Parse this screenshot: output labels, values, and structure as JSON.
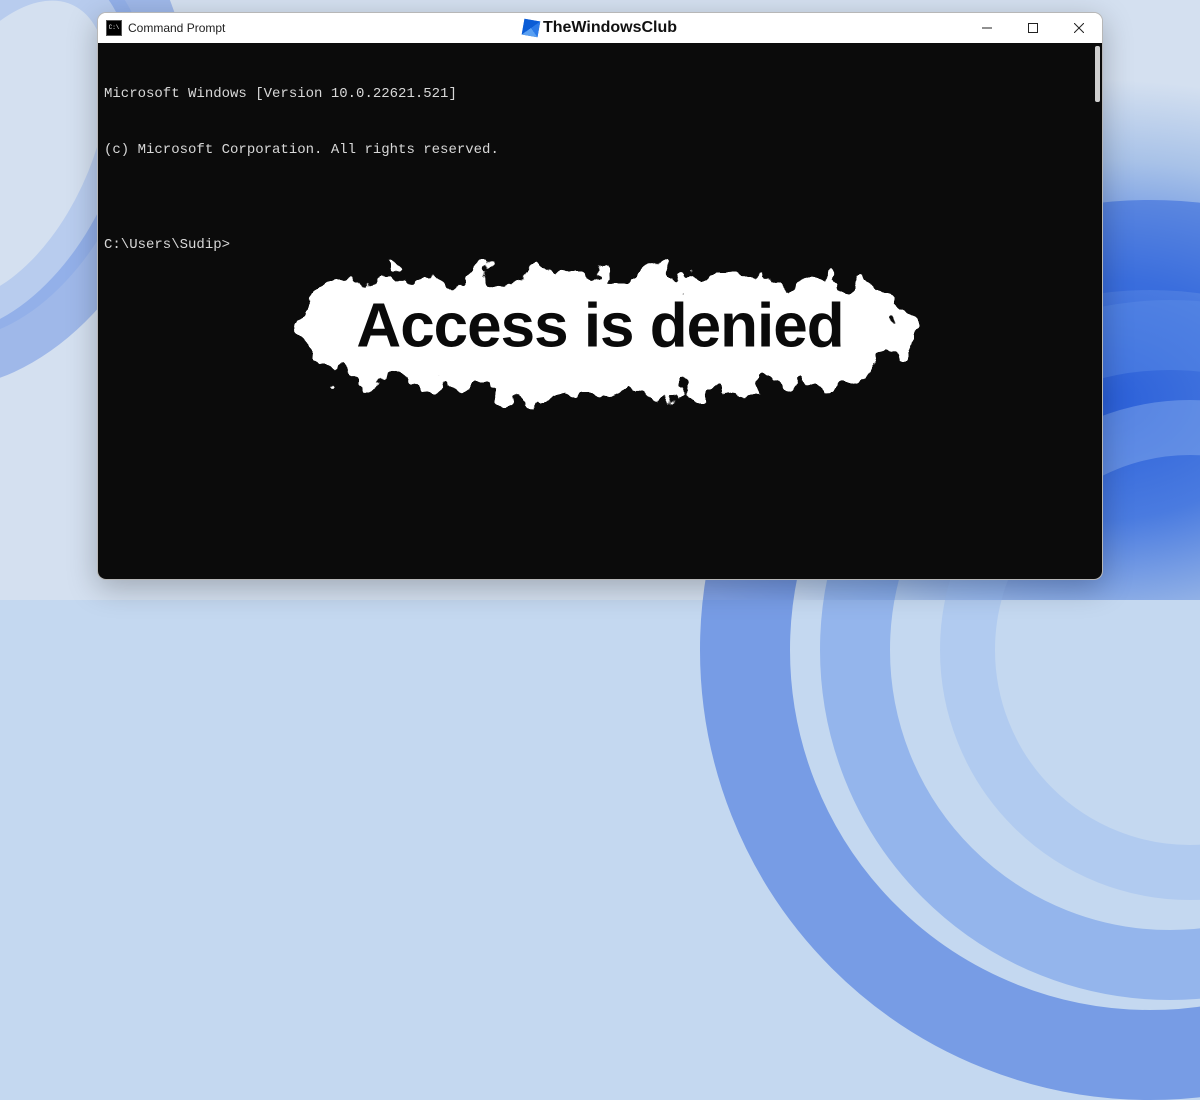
{
  "titlebar": {
    "app_title": "Command Prompt",
    "branding": "TheWindowsClub"
  },
  "window_controls": {
    "minimize": "Minimize",
    "maximize": "Maximize",
    "close": "Close"
  },
  "terminal": {
    "line1": "Microsoft Windows [Version 10.0.22621.521]",
    "line2": "(c) Microsoft Corporation. All rights reserved.",
    "blank": "",
    "prompt": "C:\\Users\\Sudip>"
  },
  "overlay": {
    "text": "Access is denied"
  },
  "icons": {
    "app": "command-prompt-icon",
    "brand": "windows-logo-icon",
    "minimize": "minimize-icon",
    "maximize": "maximize-icon",
    "close": "close-icon"
  }
}
